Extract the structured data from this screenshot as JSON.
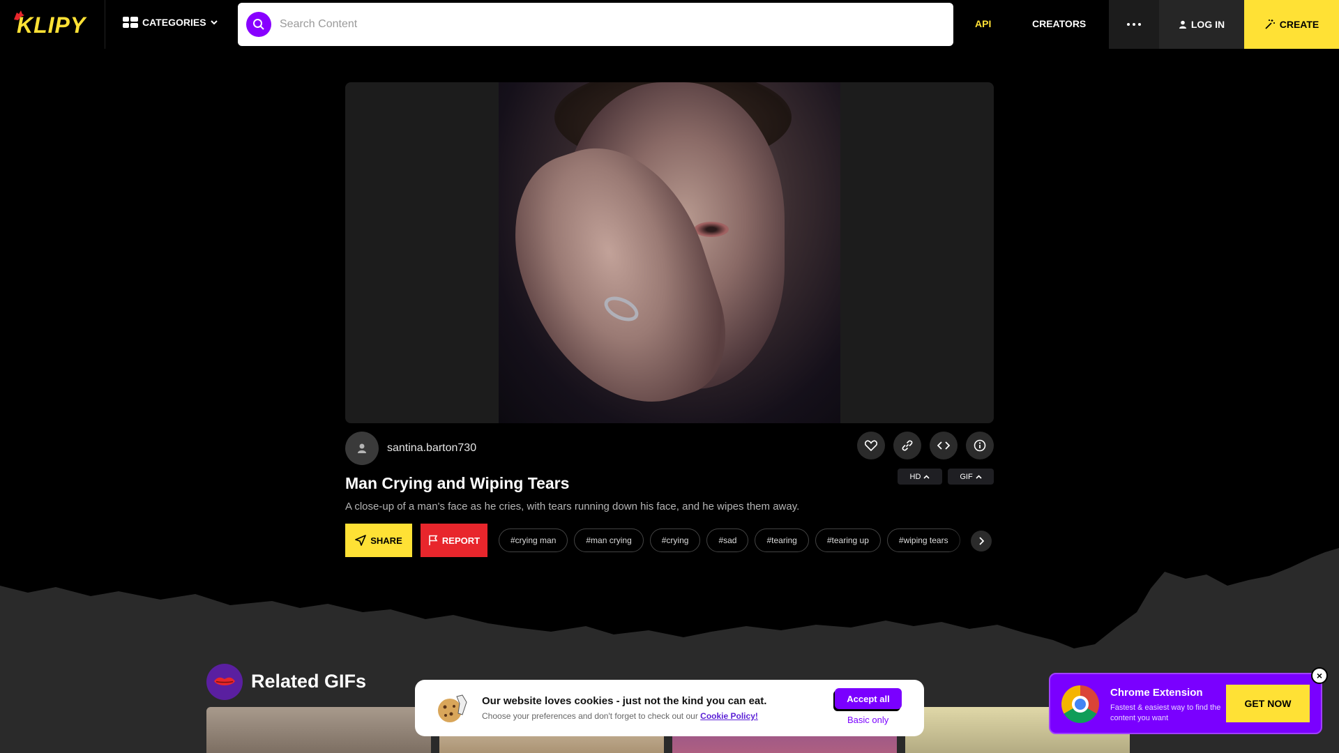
{
  "header": {
    "logo_text": "KLIPY",
    "categories_label": "CATEGORIES",
    "search_placeholder": "Search Content",
    "nav_api": "API",
    "nav_creators": "CREATORS",
    "login_label": "LOG IN",
    "create_label": "CREATE"
  },
  "gif": {
    "username": "santina.barton730",
    "title": "Man Crying and Wiping Tears",
    "description": "A close-up of a man's face as he cries, with tears running down his face, and he wipes them away.",
    "quality_label": "HD",
    "format_label": "GIF"
  },
  "actions": {
    "share_label": "SHARE",
    "report_label": "REPORT"
  },
  "tags": [
    "#crying man",
    "#man crying",
    "#crying",
    "#sad",
    "#tearing",
    "#tearing up",
    "#wiping tears"
  ],
  "related": {
    "title": "Related GIFs"
  },
  "cookie": {
    "heading": "Our website loves cookies - just not the kind you can eat.",
    "sub_text": "Choose your preferences and don't forget to check out our",
    "policy_link": "Cookie Policy!",
    "accept_label": "Accept all",
    "basic_label": "Basic only"
  },
  "chrome_ext": {
    "title": "Chrome Extension",
    "subtitle": "Fastest & easiest way to find the content you want",
    "button_label": "GET NOW",
    "close_label": "×"
  },
  "colors": {
    "brand_yellow": "#ffe135",
    "brand_purple": "#7a00ff",
    "report_red": "#e8262c",
    "background": "#000000"
  }
}
